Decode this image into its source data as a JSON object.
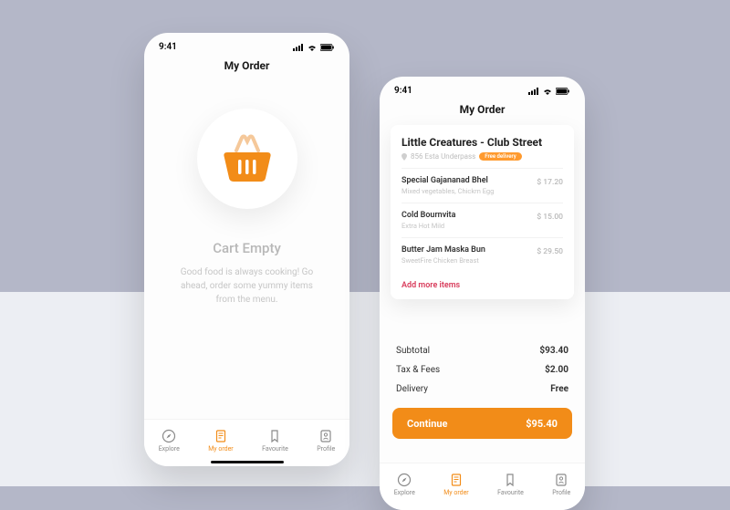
{
  "status": {
    "time": "9:41"
  },
  "page_title": "My Order",
  "empty": {
    "heading": "Cart Empty",
    "subtitle": "Good food is always cooking! Go ahead, order some yummy items from the menu."
  },
  "order": {
    "restaurant": "Little Creatures - Club Street",
    "address": "856 Esta Underpass",
    "badge": "Free delivery",
    "items": [
      {
        "name": "Special Gajananad Bhel",
        "desc": "Mixed vegetables, Chickrn Egg",
        "price": "$ 17.20"
      },
      {
        "name": "Cold Bournvita",
        "desc": "Extra Hot Mild",
        "price": "$ 15.00"
      },
      {
        "name": "Butter Jam Maska Bun",
        "desc": "SweetFire Chicken Breast",
        "price": "$ 29.50"
      }
    ],
    "add_more": "Add more items"
  },
  "totals": {
    "subtotal_label": "Subtotal",
    "subtotal": "$93.40",
    "tax_label": "Tax & Fees",
    "tax": "$2.00",
    "delivery_label": "Delivery",
    "delivery": "Free"
  },
  "cta": {
    "label": "Continue",
    "amount": "$95.40"
  },
  "nav": {
    "explore": "Explore",
    "myorder": "My order",
    "favourite": "Favourite",
    "profile": "Profile"
  }
}
